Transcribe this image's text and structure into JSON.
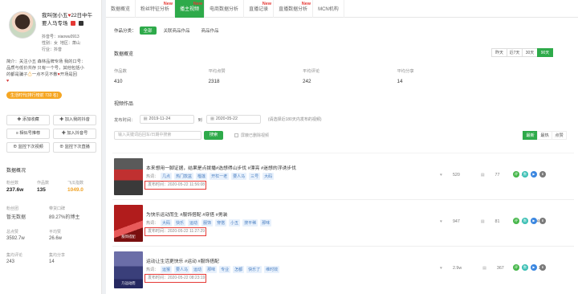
{
  "profile": {
    "name_line1": "我叫张小五",
    "name_line1b": "22日中午",
    "name_line2": "要人马专场",
    "douyin_id_label": "抖音号：",
    "douyin_id": "xiaowu0913",
    "gender_label": "性别：",
    "gender": "女",
    "region_label": "地区：",
    "region": "萧山",
    "industry_label": "行业：",
    "industry": "抖音",
    "bio_prefix": "简介：",
    "bio_lines": [
      "关注小五 森林品牌专场 我的口号：",
      "品质与低价共存 只有一个号，其他包括小",
      "的都是骗子",
      "一点不见不散",
      "开场是回",
      ""
    ],
    "fans_badge": "生活时代(排行榜前 733 名)"
  },
  "actions": [
    {
      "label": "✚ 添加收藏",
      "name": "add-favorite-button"
    },
    {
      "label": "✚ 加入我的抖音",
      "name": "add-to-my-douyin-button"
    },
    {
      "label": "≡ 相似号推荐",
      "name": "similar-accounts-button"
    },
    {
      "label": "✚ 加入抖音号",
      "name": "add-account-button"
    },
    {
      "label": "⊕ 监控下次视频",
      "name": "monitor-next-video-button"
    },
    {
      "label": "⊕ 监控下次直播",
      "name": "monitor-next-live-button"
    }
  ],
  "data_overview": {
    "title": "数据概况",
    "stats": [
      {
        "label": "粉丝数",
        "value": "237.6w",
        "color": "#222222"
      },
      {
        "label": "作品数",
        "value": "135",
        "color": "#222222"
      },
      {
        "label": "飞瓜指数",
        "value": "1049.0",
        "color": "#f0a020"
      }
    ],
    "kv": [
      {
        "label": "粉丝团",
        "value": "暂无数据"
      },
      {
        "label": "带货口碑",
        "value": "89.27%的博主"
      },
      {
        "label": "总点赞",
        "value": "3592.7w"
      },
      {
        "label": "平均赞",
        "value": "26.6w"
      },
      {
        "label": "集均评论",
        "value": "243"
      },
      {
        "label": "集均分享",
        "value": "14"
      }
    ]
  },
  "tabs": [
    {
      "label": "数据概览",
      "new": "",
      "active": false,
      "name": "tab-data-overview"
    },
    {
      "label": "粉丝特征分析",
      "new": "New",
      "active": false,
      "name": "tab-fans-analysis"
    },
    {
      "label": "播主视频",
      "new": "New",
      "active": true,
      "name": "tab-videos"
    },
    {
      "label": "电商数据分析",
      "new": "",
      "active": false,
      "name": "tab-ecommerce"
    },
    {
      "label": "直播记录",
      "new": "New",
      "active": false,
      "name": "tab-live-records"
    },
    {
      "label": "直播数据分析",
      "new": "New",
      "active": false,
      "name": "tab-live-analysis"
    },
    {
      "label": "MCN机构",
      "new": "",
      "active": false,
      "name": "tab-mcn"
    }
  ],
  "category": {
    "label": "作品分类：",
    "options": [
      {
        "label": "全部",
        "active": true
      },
      {
        "label": "关联商品作品",
        "active": false
      },
      {
        "label": "商品作品",
        "active": false
      }
    ]
  },
  "overview": {
    "title": "数据概览",
    "ranges": [
      {
        "label": "昨天",
        "active": false
      },
      {
        "label": "近7天",
        "active": false
      },
      {
        "label": "30天",
        "active": false
      },
      {
        "label": "90天",
        "active": true
      }
    ],
    "items": [
      {
        "label": "作品数",
        "value": "410"
      },
      {
        "label": "平均点赞",
        "value": "2318"
      },
      {
        "label": "平均评论",
        "value": "242"
      },
      {
        "label": "平均分享",
        "value": "14"
      }
    ]
  },
  "works": {
    "title": "视频作品",
    "date_label": "发布时间：",
    "date_from": "2019-11-24",
    "to_label": "到",
    "date_to": "2020-05-22",
    "date_hint": "(请选择近180天内发布的视频)",
    "search_placeholder": "输入关键词后回车/日期中搜索",
    "search_button": "搜索",
    "checkbox_label": "屏蔽已删除视频",
    "sort": [
      {
        "label": "最新",
        "active": true
      },
      {
        "label": "最热",
        "active": false
      },
      {
        "label": "点赞",
        "active": false
      }
    ]
  },
  "videos": [
    {
      "title": "本来想用一脚证据，结果是点拨播#选想得山步伐 #漂亮 #迷想的浮诱步伐",
      "thumb_text": "",
      "tags_label": "热词：",
      "tags": [
        "几点",
        "热门款盆",
        "榴莲",
        "开杠一老",
        "要人马",
        "三号",
        "大码"
      ],
      "pub": "发布时间：2020-05-22 11:56:08",
      "likes": "520",
      "comments": "77",
      "shares": "6"
    },
    {
      "title": "为快乐运动而生 #服饰搭配 #穿搭 #男装",
      "thumb_text": "服饰搭配",
      "tags_label": "热词：",
      "tags": [
        "大码",
        "快乐",
        "运动",
        "服饰",
        "穿搭",
        "小五",
        "搜平稀",
        "那味"
      ],
      "pub": "发布时间：2020-05-22 11:27:29",
      "likes": "947",
      "comments": "81",
      "shares": "14"
    },
    {
      "title": "运动让生活更快乐 #运动 #服饰搭配",
      "thumb_text": "乃运动而",
      "tags_label": "热词：",
      "tags": [
        "运猴",
        "要人马",
        "运动",
        "那味",
        "专业",
        "怎都",
        "快乐了",
        "维时效"
      ],
      "pub": "发布时间：2020-05-22 08:23:19",
      "likes": "2.9w",
      "comments": "367",
      "shares": "31"
    }
  ],
  "row_buttons": [
    "评",
    "数",
    "▶",
    "⬇"
  ],
  "colors": {
    "accent": "#2eaa4a",
    "alert_border": "#e53935",
    "tag_bg": "#e8f1fc",
    "tag_text": "#4a7fc1",
    "fans_badge": "#f5a623"
  }
}
